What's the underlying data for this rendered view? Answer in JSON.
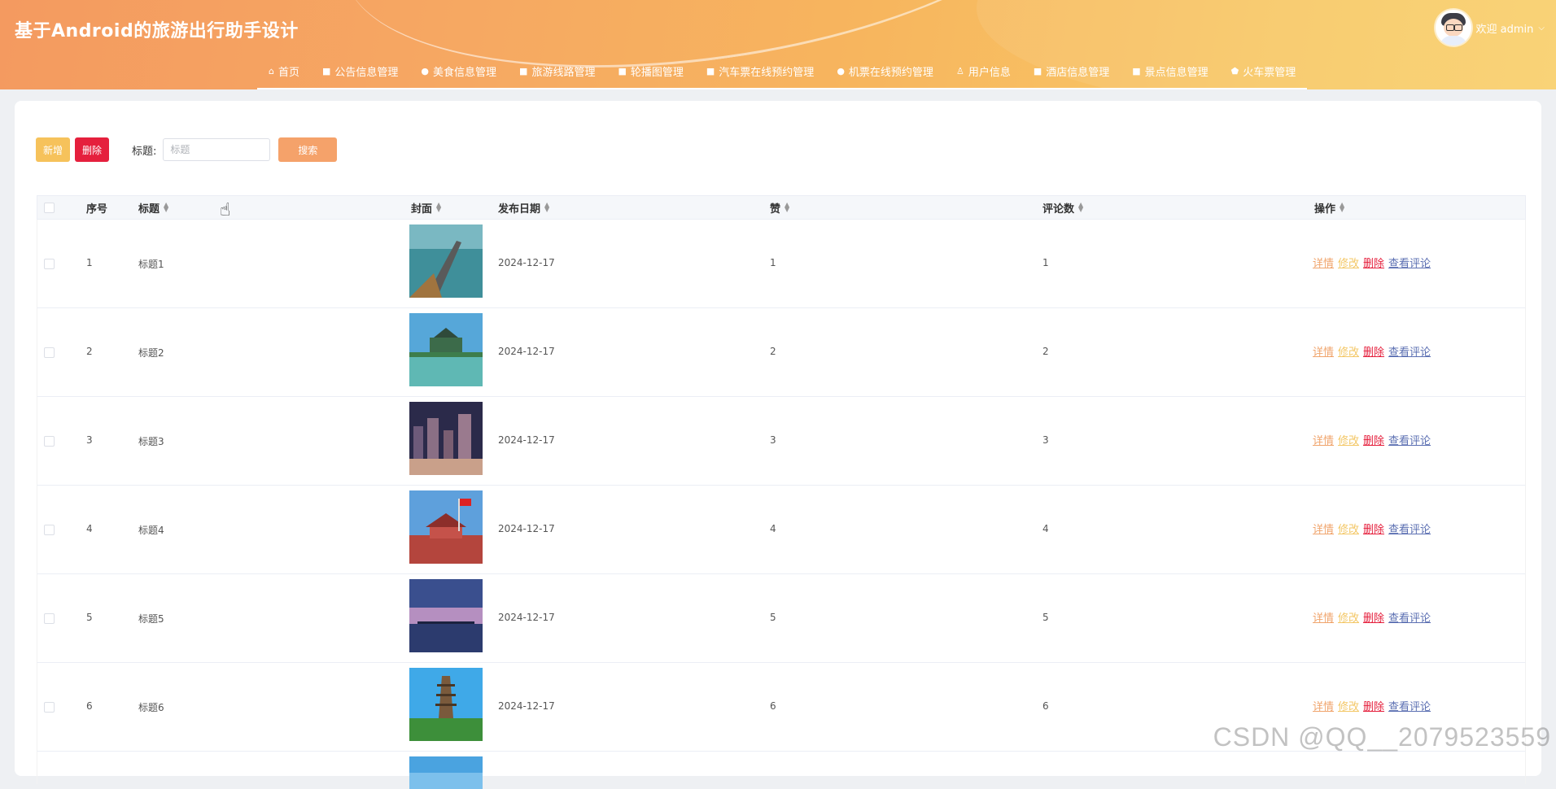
{
  "app_title": "基于Android的旅游出行助手设计",
  "user": {
    "welcome": "欢迎 admin"
  },
  "nav": [
    {
      "label": "首页",
      "icon": "home-icon",
      "glyph": "⌂"
    },
    {
      "label": "公告信息管理",
      "icon": "notice-icon",
      "glyph": "■"
    },
    {
      "label": "美食信息管理",
      "icon": "food-icon",
      "glyph": "●"
    },
    {
      "label": "旅游线路管理",
      "icon": "route-icon",
      "glyph": "■"
    },
    {
      "label": "轮播图管理",
      "icon": "carousel-icon",
      "glyph": "■"
    },
    {
      "label": "汽车票在线预约管理",
      "icon": "bus-icon",
      "glyph": "■"
    },
    {
      "label": "机票在线预约管理",
      "icon": "plane-icon",
      "glyph": "●"
    },
    {
      "label": "用户信息",
      "icon": "user-icon",
      "glyph": "♙"
    },
    {
      "label": "酒店信息管理",
      "icon": "hotel-icon",
      "glyph": "■"
    },
    {
      "label": "景点信息管理",
      "icon": "scenic-icon",
      "glyph": "■"
    },
    {
      "label": "火车票管理",
      "icon": "train-icon",
      "glyph": "⬟"
    }
  ],
  "toolbar": {
    "add_label": "新增",
    "delete_label": "删除",
    "filter_label": "标题:",
    "search_placeholder": "标题",
    "search_label": "搜索"
  },
  "table": {
    "headers": {
      "index": "序号",
      "title": "标题",
      "cover": "封面",
      "date": "发布日期",
      "likes": "赞",
      "comments": "评论数",
      "ops": "操作"
    },
    "actions": {
      "detail": "详情",
      "edit": "修改",
      "delete": "删除",
      "comments": "查看评论"
    },
    "rows": [
      {
        "index": "1",
        "title": "标题1",
        "date": "2024-12-17",
        "likes": "1",
        "comments": "1"
      },
      {
        "index": "2",
        "title": "标题2",
        "date": "2024-12-17",
        "likes": "2",
        "comments": "2"
      },
      {
        "index": "3",
        "title": "标题3",
        "date": "2024-12-17",
        "likes": "3",
        "comments": "3"
      },
      {
        "index": "4",
        "title": "标题4",
        "date": "2024-12-17",
        "likes": "4",
        "comments": "4"
      },
      {
        "index": "5",
        "title": "标题5",
        "date": "2024-12-17",
        "likes": "5",
        "comments": "5"
      },
      {
        "index": "6",
        "title": "标题6",
        "date": "2024-12-17",
        "likes": "6",
        "comments": "6"
      }
    ]
  },
  "watermark": "CSDN @QQ__2079523559"
}
